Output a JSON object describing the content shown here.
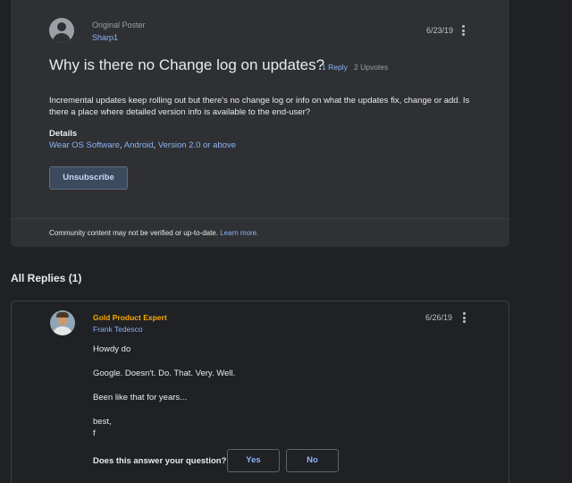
{
  "question": {
    "role_label": "Original Poster",
    "author": "Sharp1",
    "date": "6/23/19",
    "title": "Why is there no Change log on updates?",
    "reply_count": "1 Reply",
    "upvotes": "2 Upvotes",
    "body": "Incremental updates keep rolling out but there's no change log or info on what the updates fix, change or add. Is there a place where detailed version info is available to the end-user?",
    "details_heading": "Details",
    "details": [
      "Wear OS Software",
      "Android",
      "Version 2.0 or above"
    ],
    "unsubscribe_label": "Unsubscribe",
    "disclaimer_text": "Community content may not be verified or up-to-date.",
    "learn_more": "Learn more."
  },
  "replies": {
    "heading": "All Replies (1)",
    "items": [
      {
        "badge": "Gold Product Expert",
        "author": "Frank Tedesco",
        "date": "6/26/19",
        "lines": [
          "Howdy do",
          "Google. Doesn't. Do. That. Very. Well.",
          "Been like that for years...",
          "best,",
          "f"
        ],
        "answer_prompt": "Does this answer your question?",
        "yes_label": "Yes",
        "no_label": "No"
      }
    ]
  },
  "colors": {
    "background": "#202124",
    "card": "#2f3033",
    "link": "#8ab4f8",
    "expert_badge": "#f9ab00"
  },
  "icons": [
    "default-avatar-icon",
    "more-vert-icon",
    "expert-avatar"
  ]
}
